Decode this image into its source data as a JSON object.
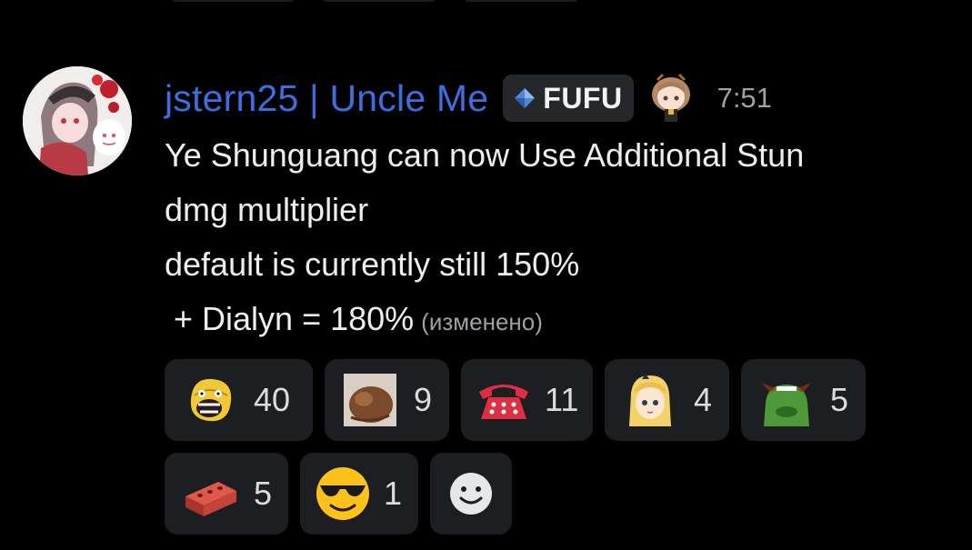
{
  "message": {
    "author": "jstern25 | Uncle Me",
    "tag": {
      "label": "FUFU",
      "icon": "diamond-gem-icon"
    },
    "role_icon": "chibi-girl-icon",
    "timestamp": "7:51",
    "lines": [
      "Ye Shunguang can now Use Additional Stun",
      "dmg multiplier",
      "default is currently still 150%",
      " + Dialyn = 180%"
    ],
    "edited_label": "(изменено)"
  },
  "reactions": [
    {
      "emoji": "screaming-face-icon",
      "count": "40"
    },
    {
      "emoji": "hair-bun-icon",
      "count": "9"
    },
    {
      "emoji": "telephone-icon",
      "count": "11"
    },
    {
      "emoji": "blonde-girl-icon",
      "count": "4"
    },
    {
      "emoji": "green-creature-icon",
      "count": "5"
    },
    {
      "emoji": "brick-icon",
      "count": "5"
    },
    {
      "emoji": "sunglasses-face-icon",
      "count": "1"
    }
  ],
  "colors": {
    "background": "#000000",
    "username": "#3d6ee0",
    "reaction_bg": "#1d1e22",
    "muted": "#9ea0a6"
  }
}
